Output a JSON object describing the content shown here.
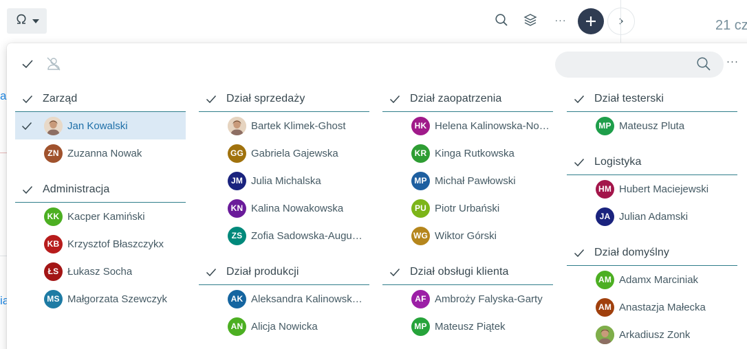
{
  "toolbar": {
    "omega_icon": "omega-icon",
    "date_fragment": "21 cz"
  },
  "panel": {
    "search": {
      "value": "",
      "placeholder": ""
    },
    "more_label": "···"
  },
  "columns": [
    {
      "groups": [
        {
          "title": "Zarząd",
          "people": [
            {
              "initials": "",
              "name": "Jan Kowalski",
              "color": "#e8d9c8",
              "photo": true,
              "selected": true
            },
            {
              "initials": "ZN",
              "name": "Zuzanna Nowak",
              "color": "#a0522d"
            }
          ]
        },
        {
          "title": "Administracja",
          "people": [
            {
              "initials": "KK",
              "name": "Kacper Kamiński",
              "color": "#4caf22"
            },
            {
              "initials": "KB",
              "name": "Krzysztof Błaszczykx",
              "color": "#b71c1c"
            },
            {
              "initials": "ŁS",
              "name": "Łukasz Socha",
              "color": "#a31515"
            },
            {
              "initials": "MS",
              "name": "Małgorzata Szewczyk",
              "color": "#1e7ba4"
            }
          ]
        }
      ]
    },
    {
      "groups": [
        {
          "title": "Dział sprzedaży",
          "people": [
            {
              "initials": "",
              "name": "Bartek Klimek-Ghost",
              "color": "#e6d4c0",
              "photo": true
            },
            {
              "initials": "GG",
              "name": "Gabriela Gajewska",
              "color": "#a0720d"
            },
            {
              "initials": "JM",
              "name": "Julia Michalska",
              "color": "#1a237e"
            },
            {
              "initials": "KN",
              "name": "Kalina Nowakowska",
              "color": "#6a1b9a"
            },
            {
              "initials": "ZS",
              "name": "Zofia Sadowska-Augustyniak",
              "color": "#00897b"
            }
          ]
        },
        {
          "title": "Dział produkcji",
          "people": [
            {
              "initials": "AK",
              "name": "Aleksandra Kalinowska-Nowak",
              "color": "#1565a0"
            },
            {
              "initials": "AN",
              "name": "Alicja Nowicka",
              "color": "#4caf22"
            }
          ]
        }
      ]
    },
    {
      "groups": [
        {
          "title": "Dział zaopatrzenia",
          "people": [
            {
              "initials": "HK",
              "name": "Helena Kalinowska-Nowak",
              "color": "#a01a8a"
            },
            {
              "initials": "KR",
              "name": "Kinga Rutkowska",
              "color": "#2e9d33"
            },
            {
              "initials": "MP",
              "name": "Michał Pawłowski",
              "color": "#1e5fa0"
            },
            {
              "initials": "PU",
              "name": "Piotr Urbański",
              "color": "#7cb518"
            },
            {
              "initials": "WG",
              "name": "Wiktor Górski",
              "color": "#b5861c"
            }
          ]
        },
        {
          "title": "Dział obsługi klienta",
          "people": [
            {
              "initials": "AF",
              "name": "Ambroży Falyska-Garty",
              "color": "#9c1ea6"
            },
            {
              "initials": "MP",
              "name": "Mateusz Piątek",
              "color": "#26a33a"
            }
          ]
        }
      ]
    },
    {
      "groups": [
        {
          "title": "Dział testerski",
          "people": [
            {
              "initials": "MP",
              "name": "Mateusz Pluta",
              "color": "#1e9e4a"
            }
          ]
        },
        {
          "title": "Logistyka",
          "people": [
            {
              "initials": "HM",
              "name": "Hubert Maciejewski",
              "color": "#a3154a"
            },
            {
              "initials": "JA",
              "name": "Julian Adamski",
              "color": "#1a237e"
            }
          ]
        },
        {
          "title": "Dział domyślny",
          "people": [
            {
              "initials": "AM",
              "name": "Adamx Marciniak",
              "color": "#4caf22"
            },
            {
              "initials": "AM",
              "name": "Anastazja Małecka",
              "color": "#a0400d"
            },
            {
              "initials": "",
              "name": "Arkadiusz Zonk",
              "color": "#7fae4a",
              "photo": true
            }
          ]
        }
      ]
    }
  ]
}
